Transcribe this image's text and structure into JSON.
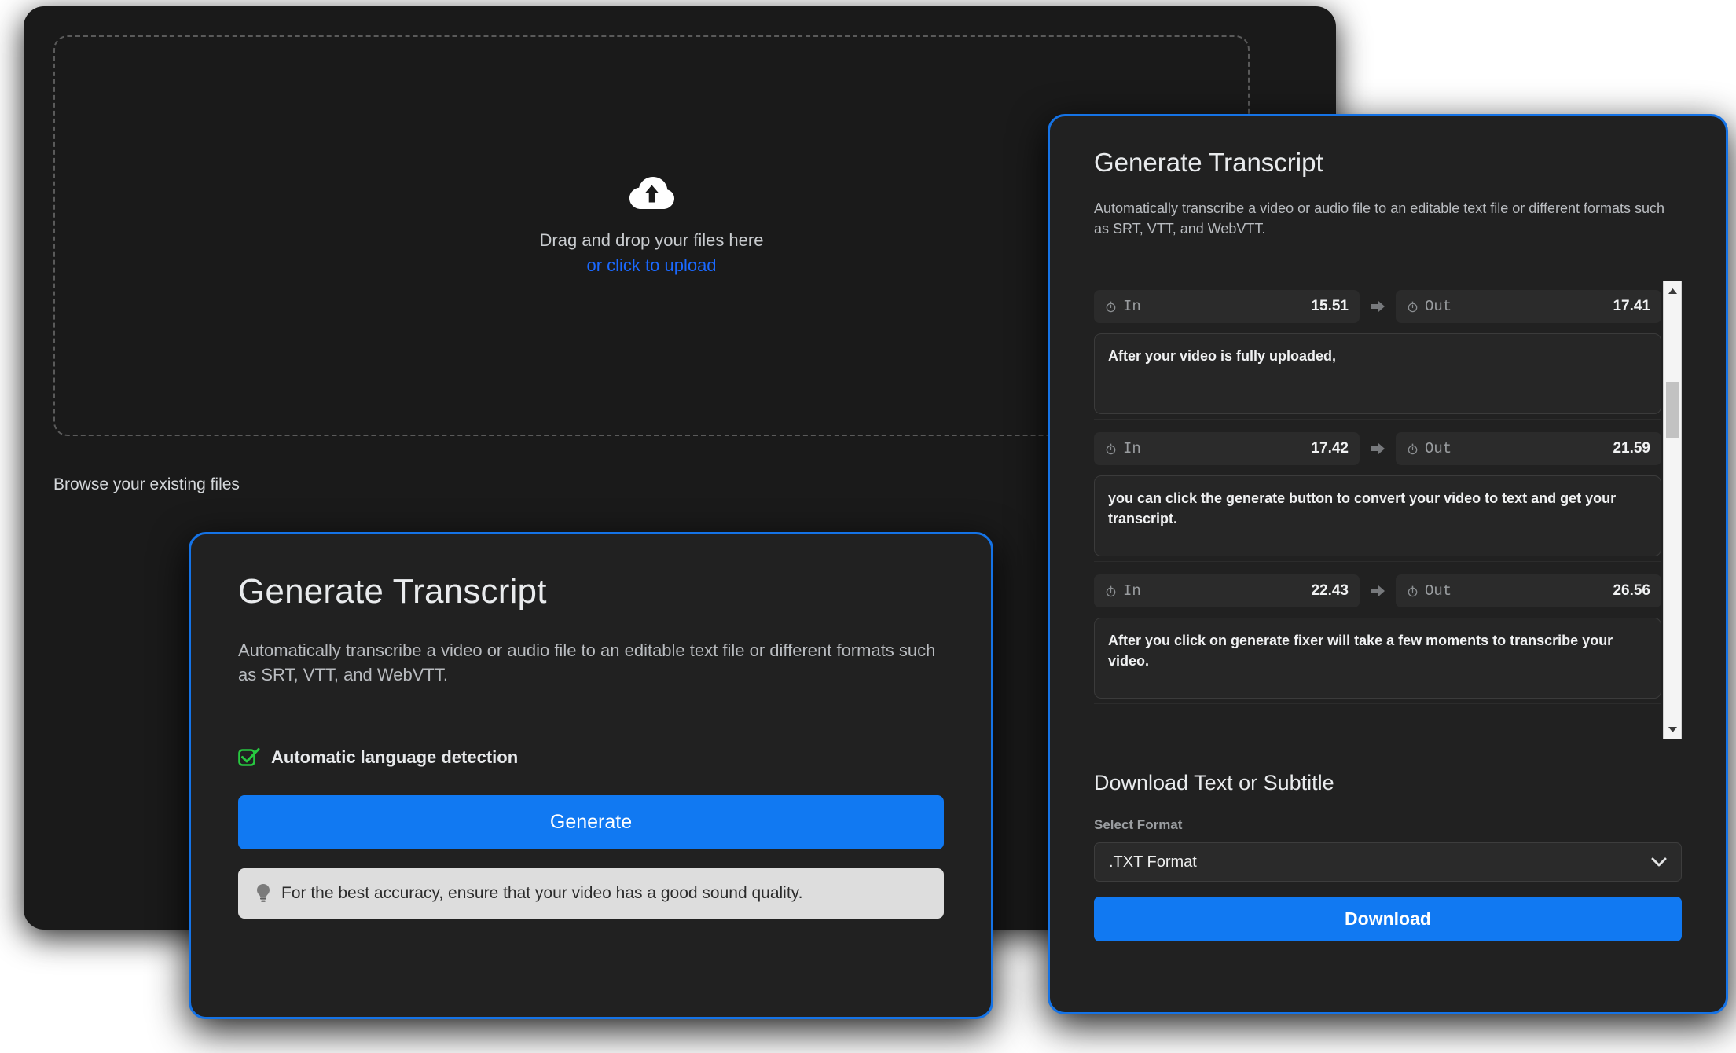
{
  "upload": {
    "dropzone_line1": "Drag and drop your files here",
    "dropzone_line2": "or click to upload",
    "cloud_icon": "cloud-upload-icon",
    "browse_label": "Browse your existing files"
  },
  "left_card": {
    "title": "Generate Transcript",
    "description": "Automatically transcribe a video or audio file to an editable text file or different formats such as SRT, VTT, and WebVTT.",
    "auto_language_label": "Automatic language detection",
    "auto_language_checked": true,
    "check_icon": "green-check-icon",
    "generate_label": "Generate",
    "hint_icon": "lightbulb-icon",
    "hint_text": "For the best accuracy, ensure that your video has a good sound quality."
  },
  "right_card": {
    "title": "Generate Transcript",
    "description": "Automatically transcribe a video or audio file to an editable text file or different formats such as SRT, VTT, and WebVTT.",
    "in_label": "In",
    "out_label": "Out",
    "clock_icon": "clock-icon",
    "arrow_icon": "arrow-right-icon",
    "segments": [
      {
        "in": "15.51",
        "out": "17.41",
        "text": "After your video is fully uploaded,"
      },
      {
        "in": "17.42",
        "out": "21.59",
        "text": "you can click the generate button to convert your video to text and get your transcript."
      },
      {
        "in": "22.43",
        "out": "26.56",
        "text": "After you click on generate fixer will take a few moments to transcribe your video."
      }
    ],
    "scrollbar": {
      "up_arrow": "scroll-up-arrow-icon",
      "down_arrow": "scroll-down-arrow-icon"
    },
    "download": {
      "title": "Download Text or Subtitle",
      "select_label": "Select Format",
      "selected_format": ".TXT Format",
      "chevron_icon": "chevron-down-icon",
      "button_label": "Download"
    }
  },
  "colors": {
    "accent_blue": "#1179f2",
    "border_blue": "#1573e6",
    "link_blue": "#1b69ff",
    "check_green": "#27c840",
    "panel_bg": "#212121",
    "surface_bg": "#1a1a1a"
  }
}
